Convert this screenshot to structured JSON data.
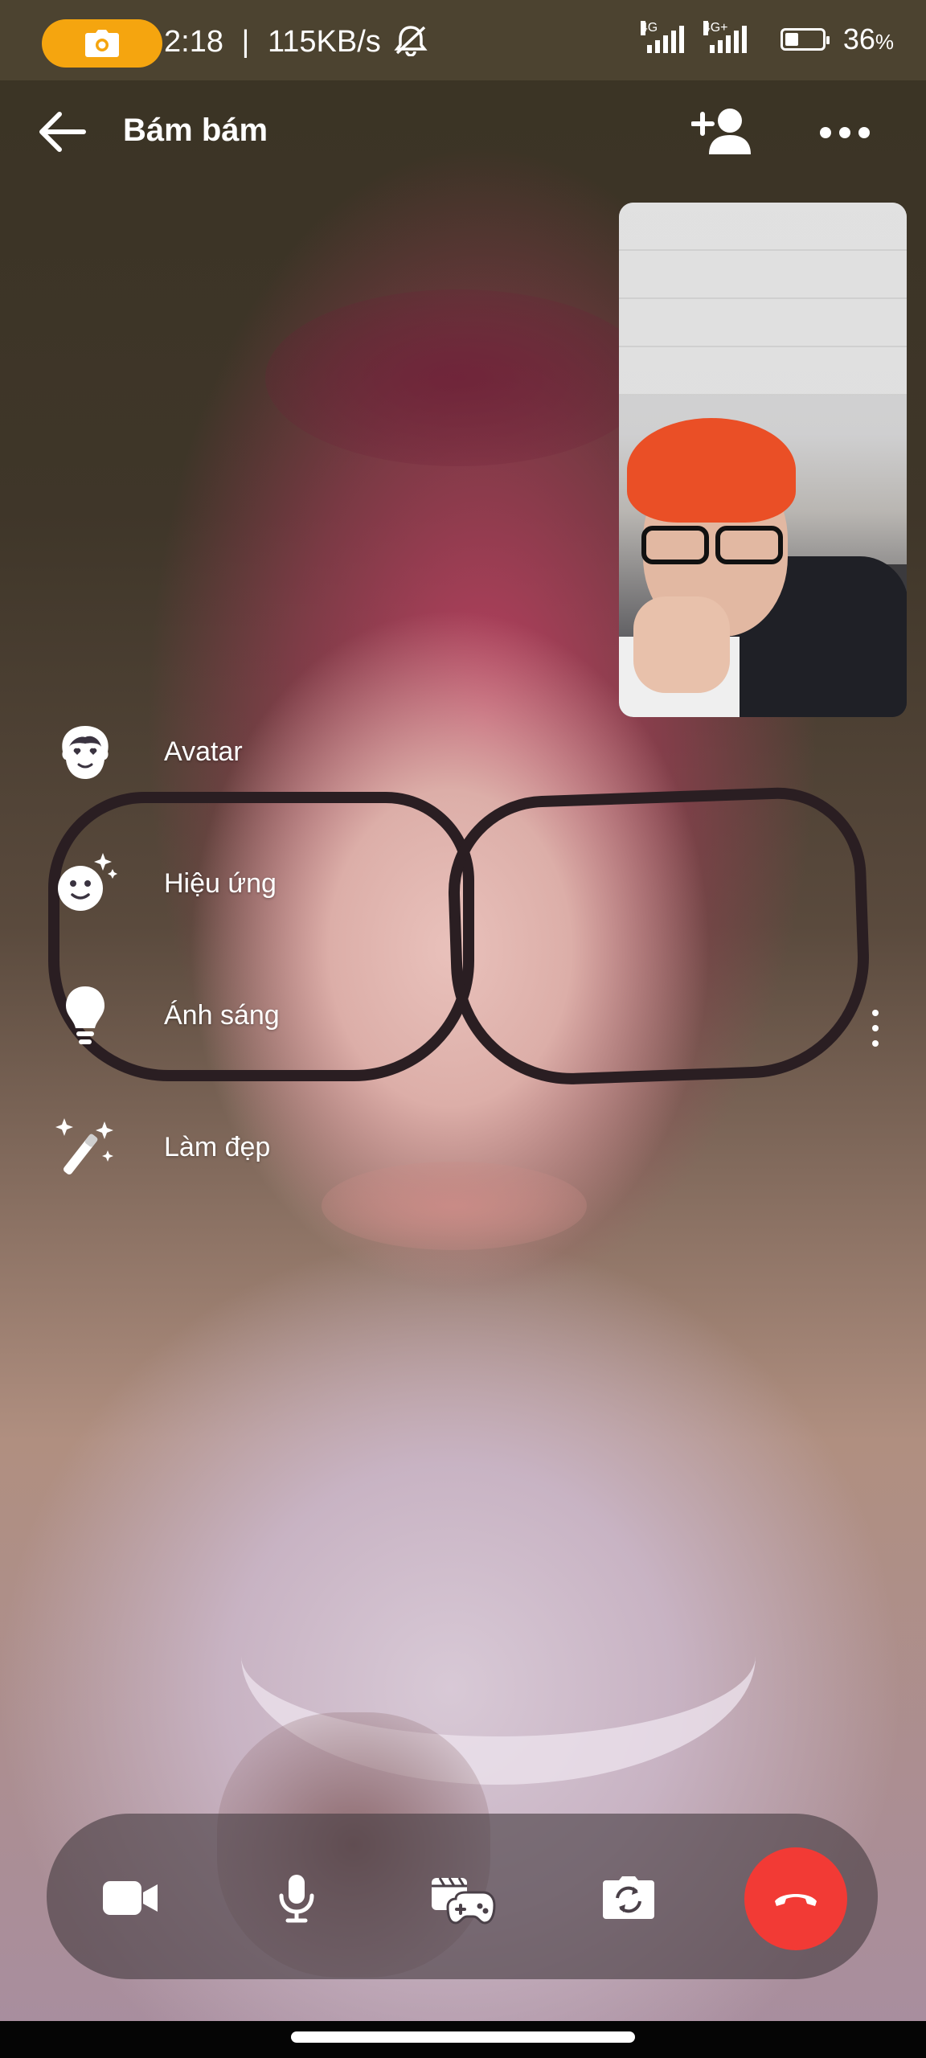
{
  "status_bar": {
    "time": "2:18",
    "separator": "|",
    "network_speed": "115KB/s",
    "signal_1_label": "4G",
    "signal_2_label": "4G+",
    "battery_percent": "36",
    "battery_unit": "%",
    "battery_level": 0.36,
    "recording_pill_color": "#f5a50f",
    "icons": [
      "camera-icon",
      "alarm-off-icon",
      "signal-icon",
      "battery-icon"
    ]
  },
  "header": {
    "title": "Bám bám",
    "icons": [
      "back-arrow-icon",
      "add-person-icon",
      "more-horizontal-icon"
    ]
  },
  "effects_menu": {
    "items": [
      {
        "label": "Avatar",
        "icon": "avatar-icon"
      },
      {
        "label": "Hiệu ứng",
        "icon": "effects-icon"
      },
      {
        "label": "Ánh sáng",
        "icon": "light-bulb-icon"
      },
      {
        "label": "Làm đẹp",
        "icon": "beauty-wand-icon"
      }
    ]
  },
  "controls": {
    "items": [
      {
        "name": "camera-toggle",
        "icon": "video-camera-icon"
      },
      {
        "name": "microphone-toggle",
        "icon": "microphone-icon"
      },
      {
        "name": "games",
        "icon": "game-controller-icon"
      },
      {
        "name": "switch-camera",
        "icon": "flip-camera-icon"
      }
    ],
    "end_call_icon": "hang-up-icon",
    "end_call_color": "#f23a35"
  }
}
